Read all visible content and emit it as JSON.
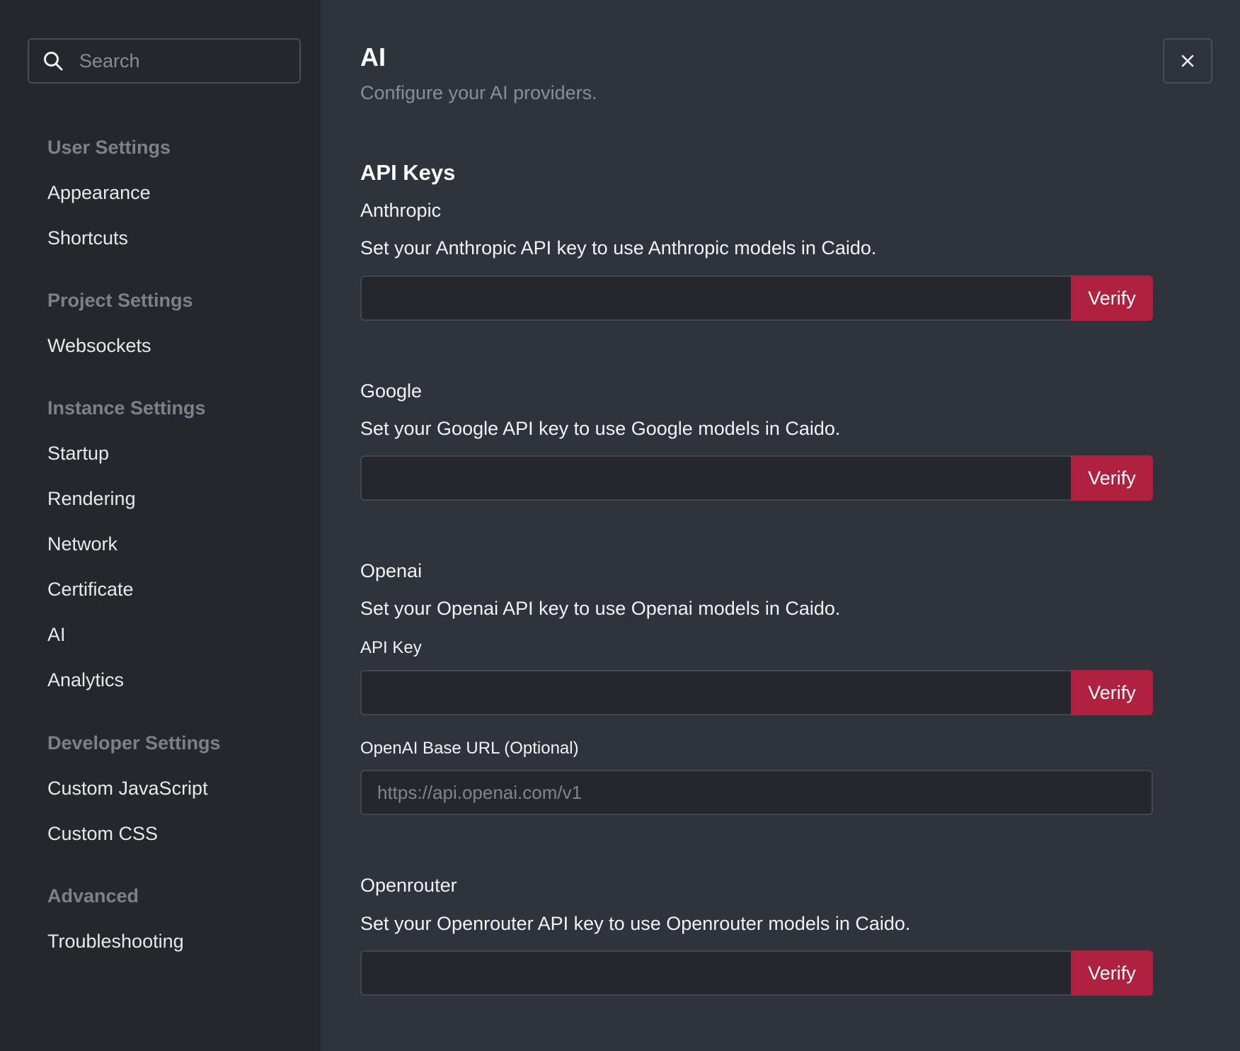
{
  "sidebar": {
    "search": {
      "placeholder": "Search"
    },
    "sections": {
      "user": {
        "title": "User Settings",
        "items": [
          "Appearance",
          "Shortcuts"
        ]
      },
      "project": {
        "title": "Project Settings",
        "items": [
          "Websockets"
        ]
      },
      "instance": {
        "title": "Instance Settings",
        "items": [
          "Startup",
          "Rendering",
          "Network",
          "Certificate",
          "AI",
          "Analytics"
        ]
      },
      "developer": {
        "title": "Developer Settings",
        "items": [
          "Custom JavaScript",
          "Custom CSS"
        ]
      },
      "advanced": {
        "title": "Advanced",
        "items": [
          "Troubleshooting"
        ]
      }
    }
  },
  "page": {
    "title": "AI",
    "subtitle": "Configure your AI providers.",
    "close_icon": "close-icon"
  },
  "api_keys": {
    "title": "API Keys",
    "verify_label": "Verify",
    "anthropic": {
      "name": "Anthropic",
      "description": "Set your Anthropic API key to use Anthropic models in Caido.",
      "value": ""
    },
    "google": {
      "name": "Google",
      "description": "Set your Google API key to use Google models in Caido.",
      "value": ""
    },
    "openai": {
      "name": "Openai",
      "description": "Set your Openai API key to use Openai models in Caido.",
      "key_label": "API Key",
      "value": "",
      "base_url_label": "OpenAI Base URL (Optional)",
      "base_url_placeholder": "https://api.openai.com/v1"
    },
    "openrouter": {
      "name": "Openrouter",
      "description": "Set your Openrouter API key to use Openrouter models in Caido.",
      "value": ""
    }
  },
  "colors": {
    "accent": "#b0203f",
    "sidebar_bg": "#25272d",
    "main_bg": "#2f333b"
  }
}
